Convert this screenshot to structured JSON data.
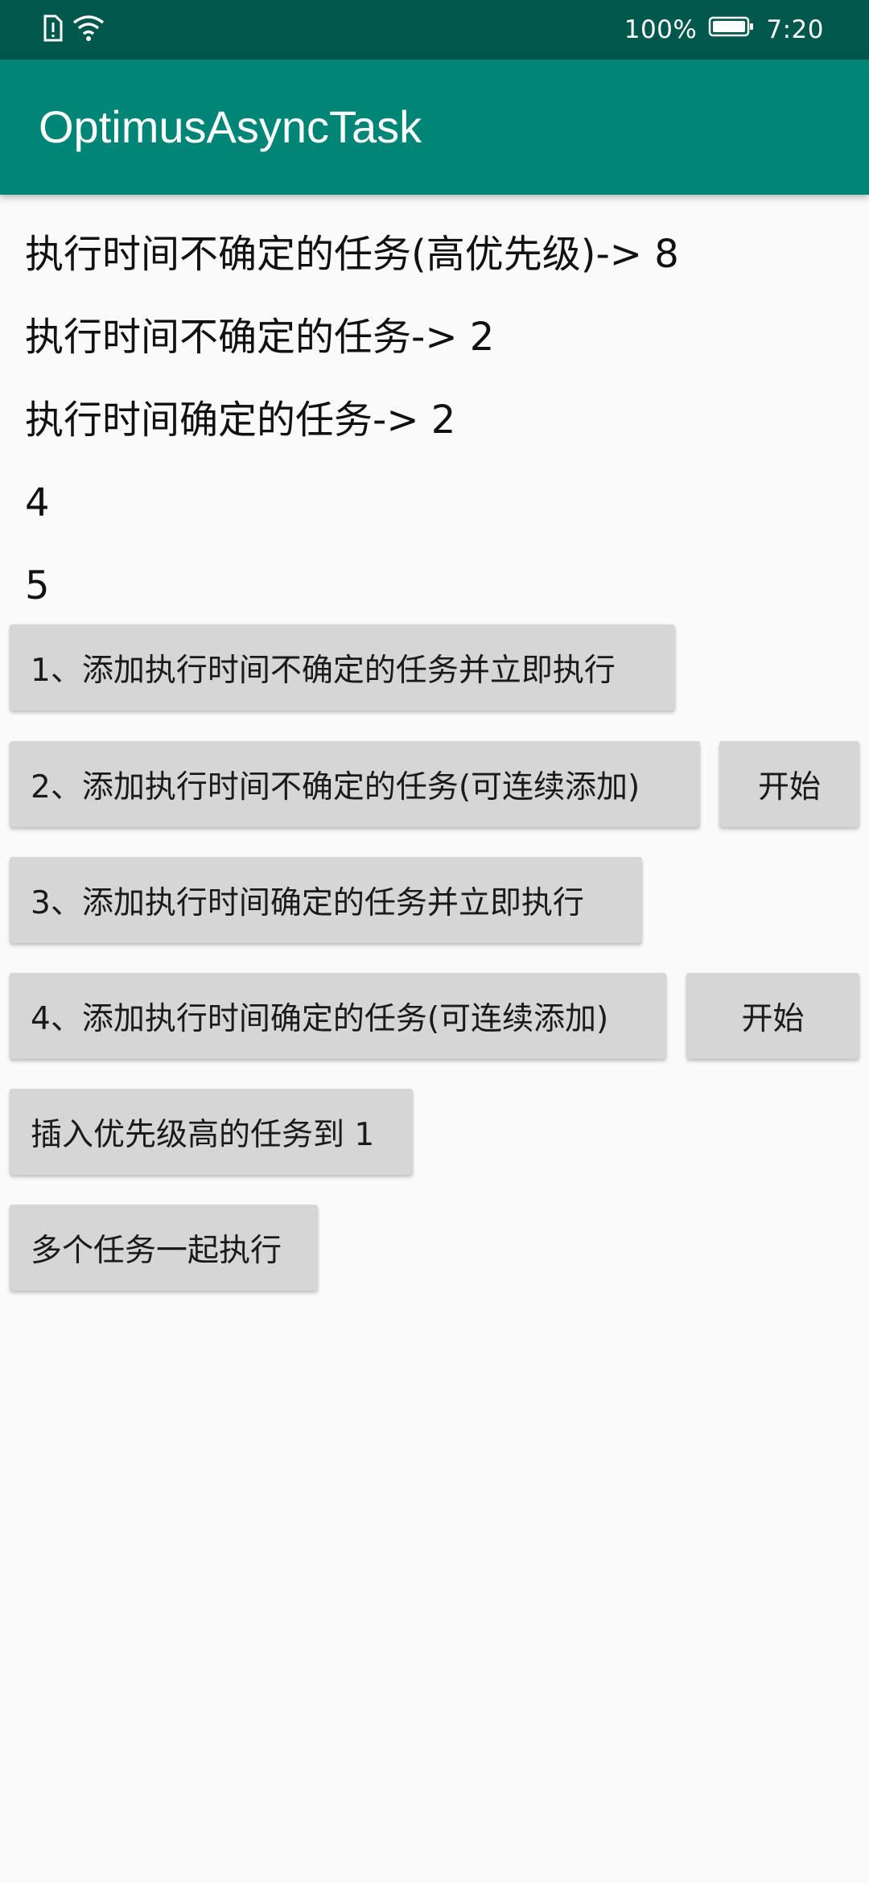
{
  "status_bar": {
    "battery_percent": "100%",
    "time": "7:20",
    "icons": [
      "sim-alert-icon",
      "wifi-icon",
      "battery-icon"
    ]
  },
  "app_bar": {
    "title": "OptimusAsyncTask"
  },
  "lines": [
    "执行时间不确定的任务(高优先级)-> 8",
    "执行时间不确定的任务-> 2",
    "执行时间确定的任务-> 2",
    "4",
    "5"
  ],
  "buttons": {
    "btn1": "1、添加执行时间不确定的任务并立即执行",
    "btn2": "2、添加执行时间不确定的任务(可连续添加)",
    "btn2_start": "开始",
    "btn3": "3、添加执行时间确定的任务并立即执行",
    "btn4": "4、添加执行时间确定的任务(可连续添加)",
    "btn4_start": "开始",
    "btn5": "插入优先级高的任务到 1",
    "btn6": "多个任务一起执行"
  },
  "colors": {
    "status_bar": "#00574b",
    "app_bar": "#008577",
    "background": "#fafafa",
    "button": "#d6d6d6"
  }
}
